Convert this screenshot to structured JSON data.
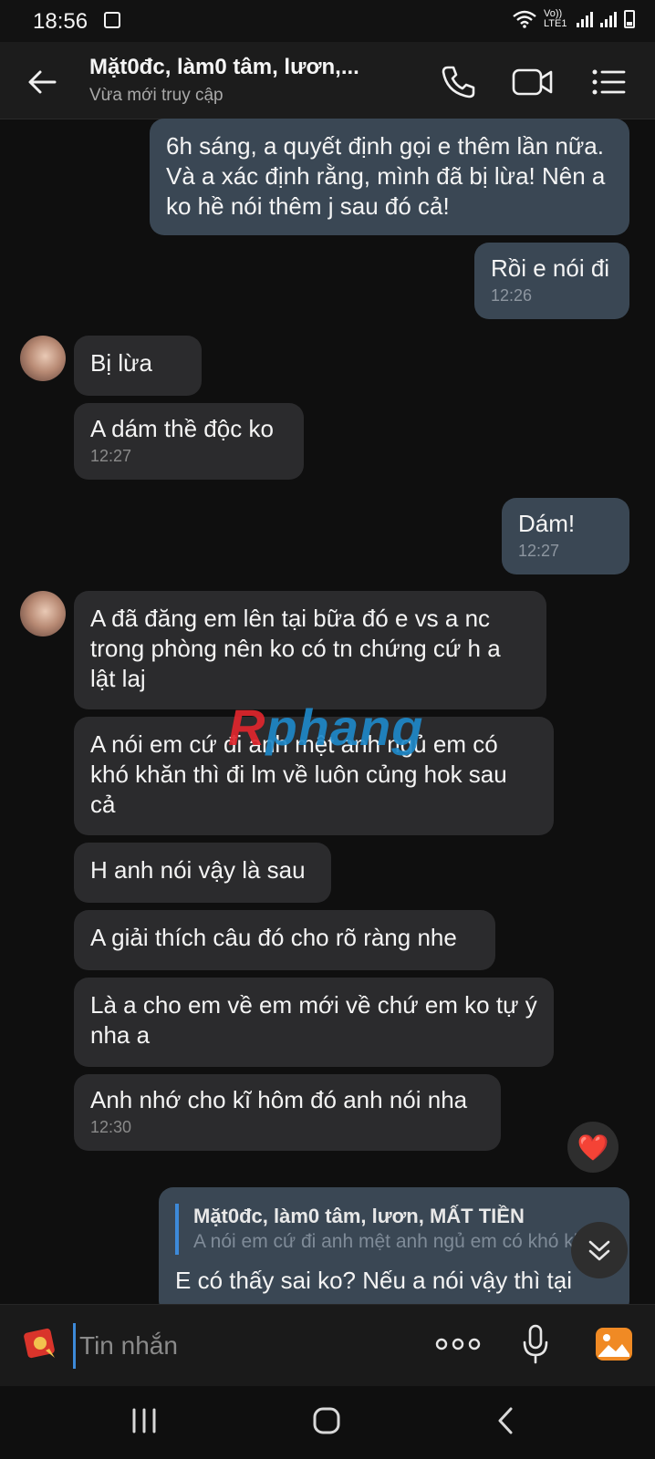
{
  "status_bar": {
    "time": "18:56",
    "network_label": "Vo)) LTE1"
  },
  "header": {
    "title": "Mặt0đc, làm0 tâm, lươn,...",
    "subtitle": "Vừa mới truy cập"
  },
  "messages": [
    {
      "dir": "out",
      "text": "6h sáng, a quyết định gọi e thêm lần nữa. Và a xác định rằng, mình đã bị lừa! Nên a ko hề nói thêm j sau đó cả!",
      "time": ""
    },
    {
      "dir": "out",
      "text": "Rồi e nói đi",
      "time": "12:26"
    },
    {
      "dir": "in",
      "text": "Bị lừa",
      "time": ""
    },
    {
      "dir": "in",
      "text": "A dám thề độc ko",
      "time": "12:27"
    },
    {
      "dir": "out",
      "text": "Dám!",
      "time": "12:27"
    },
    {
      "dir": "in",
      "text": "A đã đăng em lên tại bữa đó e vs a nc trong phòng nên ko có tn chứng cứ h a lật laj",
      "time": ""
    },
    {
      "dir": "in",
      "text": "A nói em cứ đi anh mệt anh ngủ em có khó khăn thì đi lm về luôn củng hok sau cả",
      "time": ""
    },
    {
      "dir": "in",
      "text": "H anh nói vậy là sau",
      "time": ""
    },
    {
      "dir": "in",
      "text": "A giải thích câu đó cho rõ ràng nhe",
      "time": ""
    },
    {
      "dir": "in",
      "text": "Là a cho em về em mới về chứ em ko tự ý nha a",
      "time": ""
    },
    {
      "dir": "in",
      "text": "Anh nhớ cho kĩ hôm đó anh nói nha",
      "time": "12:30"
    }
  ],
  "reaction": "❤️",
  "reply": {
    "name": "Mặt0đc, làm0 tâm, lươn, MẤT TIỀN",
    "quoted": "A nói em cứ đi anh mệt anh ngủ em có khó khăn",
    "text": "E có thấy sai ko? Nếu a nói vậy thì tại"
  },
  "watermark": {
    "first": "R",
    "rest": "phang"
  },
  "input": {
    "placeholder": "Tin nhắn"
  },
  "colors": {
    "accent": "#3d8ad9",
    "outgoing": "#3a4754",
    "incoming": "#2b2b2d",
    "gallery": "#f08a24"
  }
}
